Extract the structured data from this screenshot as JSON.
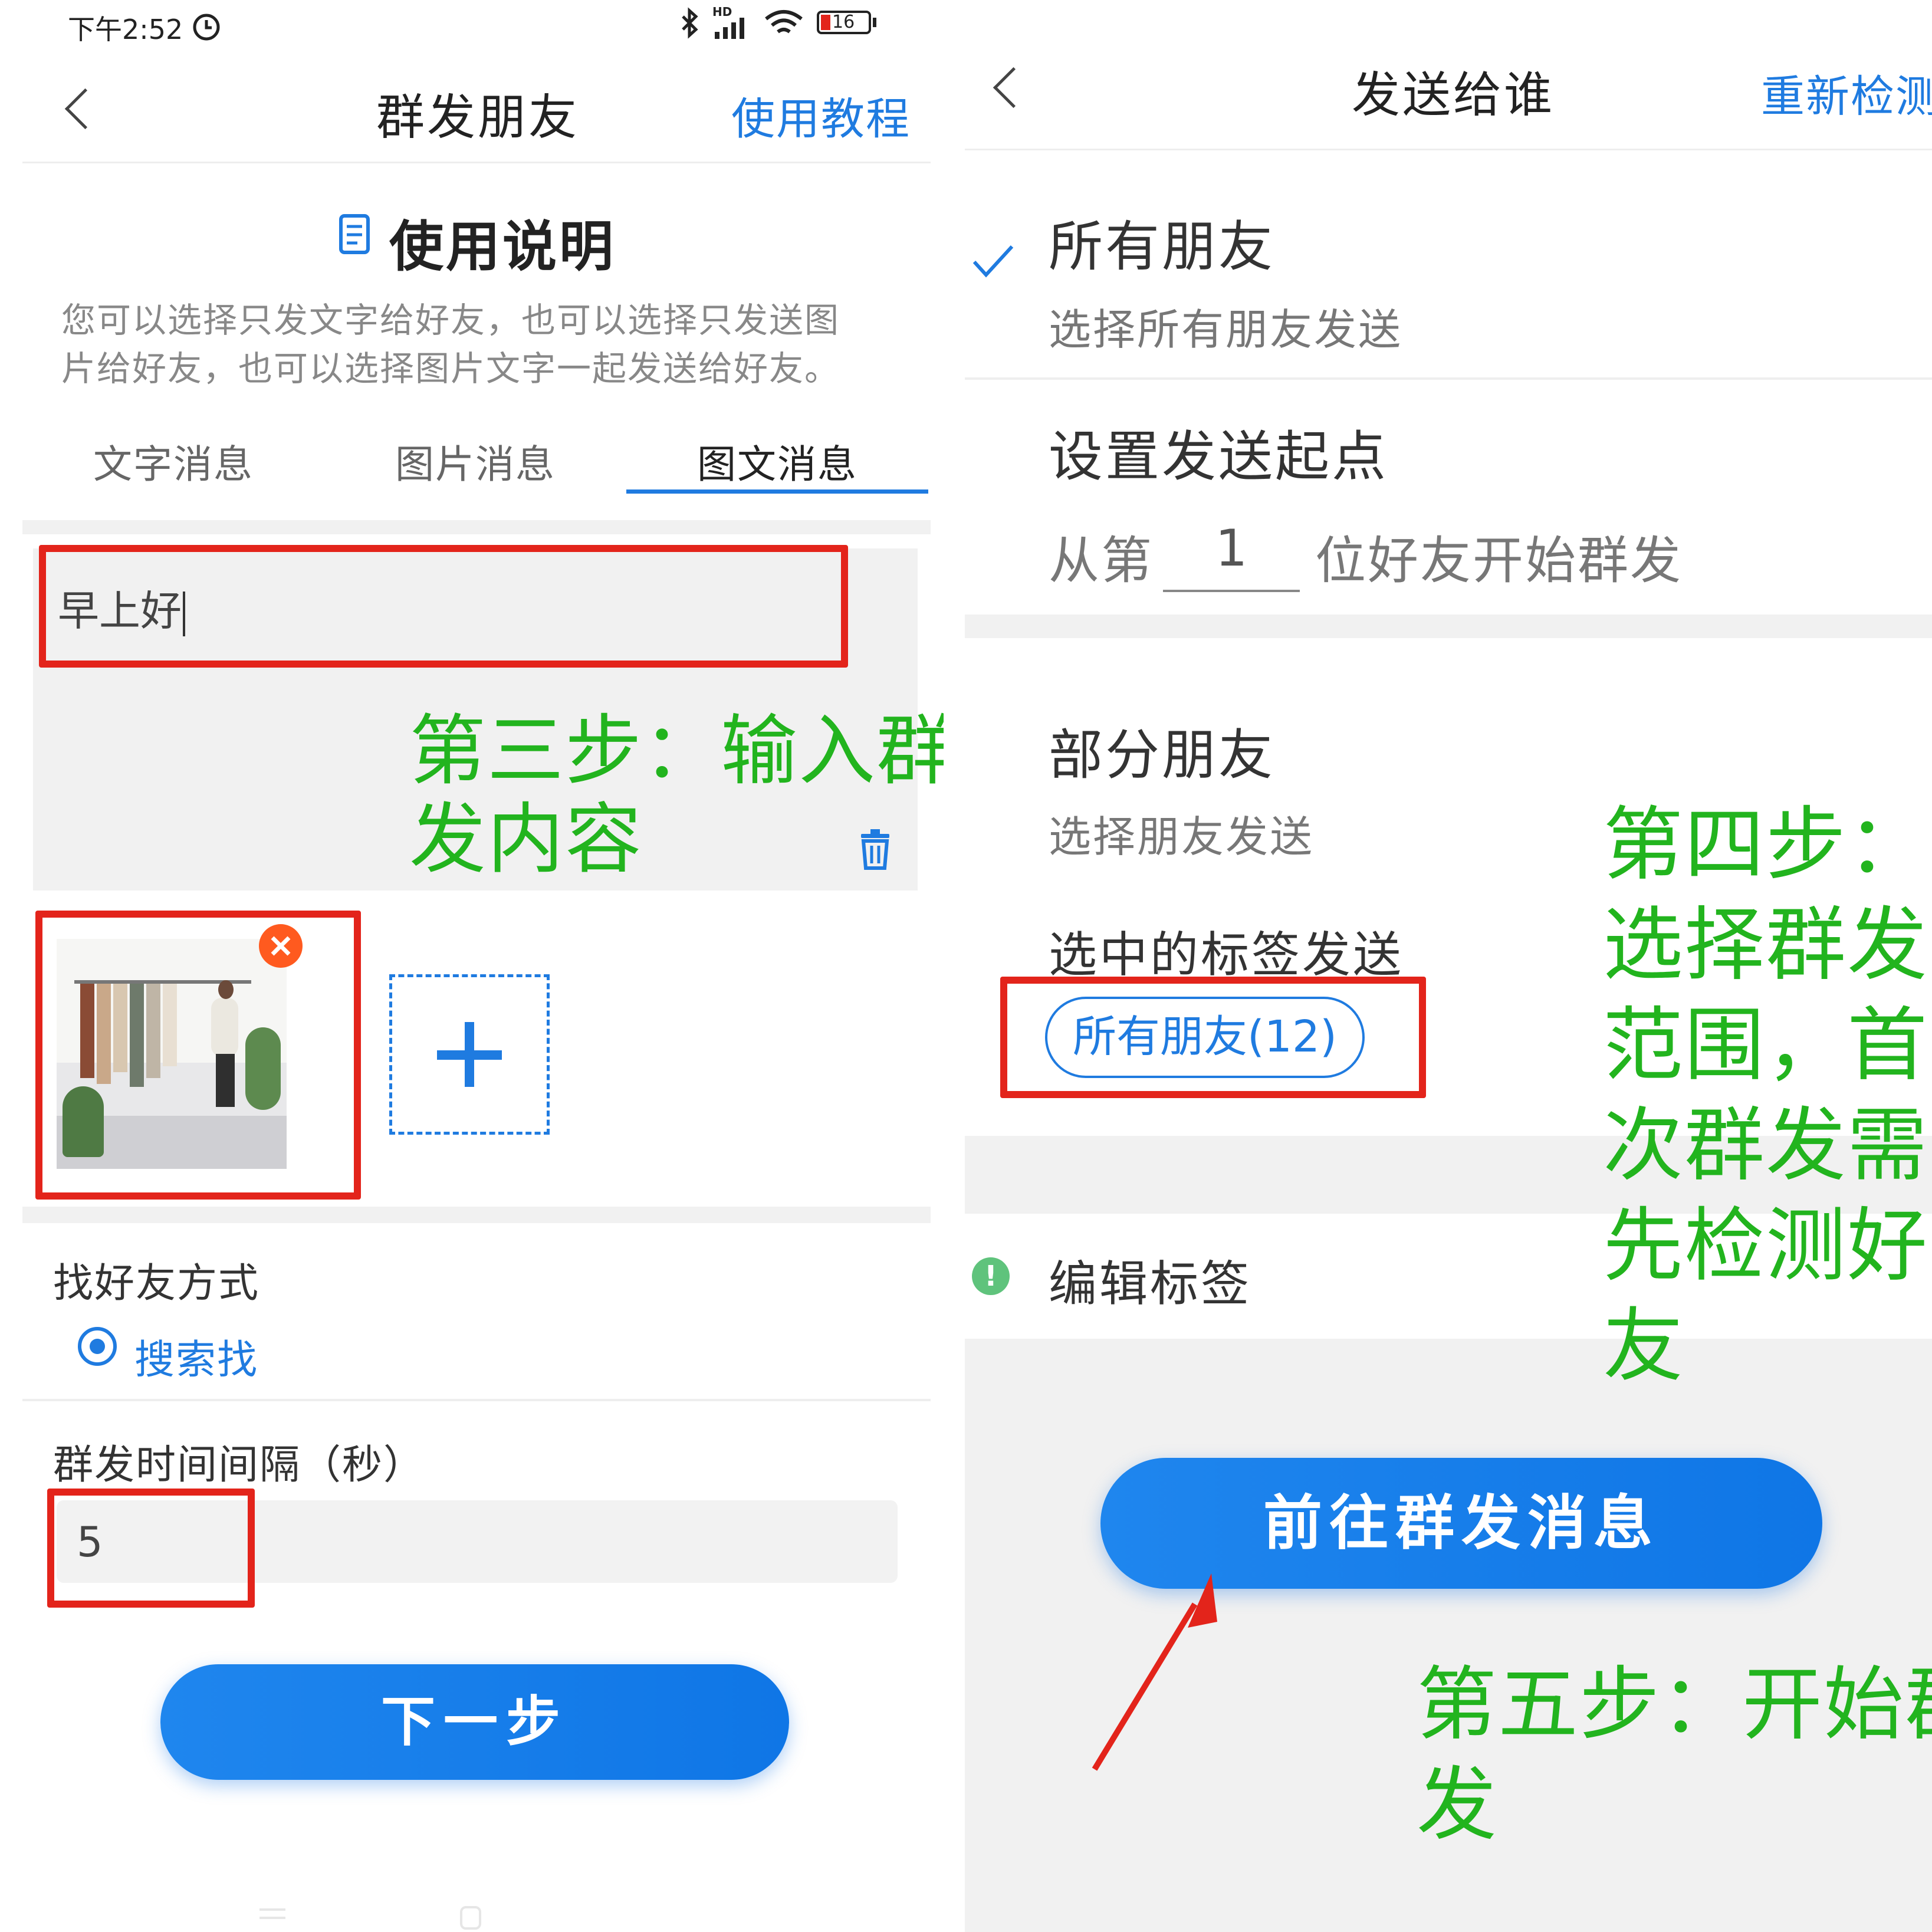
{
  "left": {
    "status": {
      "time": "下午2:52",
      "battery": "16",
      "network": "HD"
    },
    "nav": {
      "title": "群发朋友",
      "action": "使用教程"
    },
    "instructions": {
      "heading": "使用说明",
      "body_line1": "您可以选择只发文字给好友，也可以选择只发送图",
      "body_line2": "片给好友，也可以选择图片文字一起发送给好友。"
    },
    "tabs": [
      {
        "label": "文字消息",
        "active": false
      },
      {
        "label": "图片消息",
        "active": false
      },
      {
        "label": "图文消息",
        "active": true
      }
    ],
    "message_input": {
      "value": "早上好"
    },
    "annotation_step3_line1": "第三步：输入群",
    "annotation_step3_line2": "发内容",
    "find_friends": {
      "label": "找好友方式",
      "option": "搜索找"
    },
    "interval": {
      "label": "群发时间间隔（秒）",
      "value": "5"
    },
    "next_button": "下一步"
  },
  "right": {
    "nav": {
      "title": "发送给谁",
      "action": "重新检测"
    },
    "all_friends": {
      "title": "所有朋友",
      "subtitle": "选择所有朋友发送",
      "checked": true
    },
    "start_point": {
      "title": "设置发送起点",
      "prefix": "从第",
      "value": "1",
      "suffix": "位好友开始群发"
    },
    "partial_friends": {
      "title": "部分朋友",
      "subtitle": "选择朋友发送"
    },
    "tags": {
      "label": "选中的标签发送",
      "chip": "所有朋友(12)"
    },
    "edit_tags": "编辑标签",
    "annotation_step4": [
      "第四步：",
      "选择群发",
      "范围，首",
      "次群发需",
      "先检测好",
      "友"
    ],
    "go_button": "前往群发消息",
    "annotation_step5_line1": "第五步：开始群",
    "annotation_step5_line2": "发"
  },
  "colors": {
    "accent": "#1f7be0",
    "annotation_red": "#e3241b",
    "annotation_green": "#22b41e"
  }
}
